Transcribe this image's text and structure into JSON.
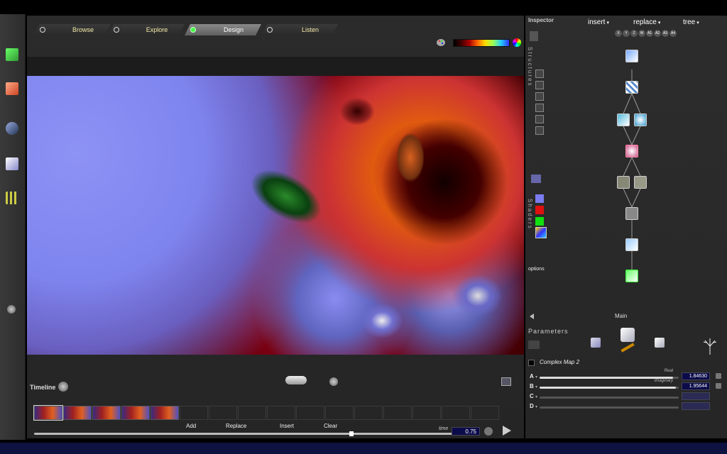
{
  "modes": [
    {
      "label": "Browse",
      "active": false
    },
    {
      "label": "Explore",
      "active": false
    },
    {
      "label": "Design",
      "active": true
    },
    {
      "label": "Listen",
      "active": false
    }
  ],
  "timeline": {
    "label": "Timeline",
    "buttons": {
      "add": "Add",
      "replace": "Replace",
      "insert": "Insert",
      "clear": "Clear"
    },
    "time_label": "time",
    "time_value": "0.75",
    "time_fraction": 0.75
  },
  "inspector": {
    "title": "Inspector",
    "menus": {
      "insert": "insert",
      "replace": "replace",
      "tree": "tree"
    },
    "variables": [
      "X",
      "Y",
      "Z",
      "W",
      "A1",
      "A2",
      "A3",
      "A4"
    ],
    "structures_label": "Structures",
    "shaders_label": "Shaders",
    "options_label": "options",
    "main_label": "Main",
    "parameters_label": "Parameters",
    "complex_map_label": "Complex Map 2",
    "params": [
      {
        "label": "A",
        "caption": "Real",
        "value": "1.84630",
        "fraction": 0.96
      },
      {
        "label": "B",
        "caption": "Imaginary",
        "value": "1.95644",
        "fraction": 0.98
      },
      {
        "label": "C",
        "caption": "",
        "value": "",
        "fraction": 0
      },
      {
        "label": "D",
        "caption": "",
        "value": "",
        "fraction": 0
      }
    ]
  },
  "colors": {
    "accent_yellow": "#f2e9a8",
    "value_field": "#0b0b4a",
    "shader_1": "#7b7bf0",
    "shader_2": "#e01010",
    "shader_3": "#10e010"
  }
}
